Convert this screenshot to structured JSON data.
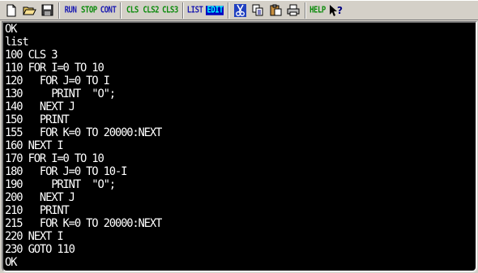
{
  "toolbar": {
    "run": "RUN",
    "stop": "STOP",
    "cont": "CONT",
    "cls": "CLS",
    "cls2": "CLS2",
    "cls3": "CLS3",
    "list": "LIST",
    "edit": "EDIT",
    "help": "HELP",
    "icons": [
      "new-file-icon",
      "open-folder-icon",
      "save-disk-icon",
      "cut-scissors-icon",
      "copy-icon",
      "paste-icon",
      "print-icon",
      "context-help-icon"
    ]
  },
  "screen": {
    "lines": [
      "OK",
      "list",
      "100 CLS 3",
      "110 FOR I=0 TO 10",
      "120   FOR J=0 TO I",
      "130     PRINT  \"O\";",
      "140   NEXT J",
      "150   PRINT",
      "155   FOR K=0 TO 20000:NEXT",
      "160 NEXT I",
      "170 FOR I=0 TO 10",
      "180   FOR J=0 TO 10-I",
      "190     PRINT  \"O\";",
      "200   NEXT J",
      "210   PRINT",
      "215   FOR K=0 TO 20000:NEXT",
      "220 NEXT I",
      "230 GOTO 110",
      "OK"
    ]
  },
  "colors": {
    "screen_bg": "#000000",
    "screen_text": "#ffffff",
    "toolbar_bg": "#d4d0c8"
  }
}
